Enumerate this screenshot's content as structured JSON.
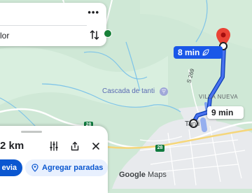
{
  "top_card": {
    "more_label": "•••",
    "destination_partial": "lor"
  },
  "route": {
    "primary_time": "8 min",
    "alt_time": "9 min"
  },
  "map": {
    "poi_name": "Cascada de tanti",
    "town_1": "VILLA NUEVA",
    "town_2": "Tanti",
    "road_s269": "S 269",
    "road_badge_a": "28",
    "road_badge_b": "28",
    "attribution_google": "Google",
    "attribution_maps": " Maps"
  },
  "sheet": {
    "distance": "2 km",
    "start_label": "evia",
    "add_stops_label": "Agregar paradas"
  },
  "colors": {
    "route_primary": "#1a57e8",
    "route_alt": "#7fa0ef",
    "map_green": "#cfe8d6",
    "map_urban": "#e8eaed",
    "water": "#7fc4e8",
    "destination_pin": "#ea4335"
  },
  "icons": {
    "swap": "swap-vertical-icon",
    "leaf": "eco-leaf-icon",
    "tune": "tune-icon",
    "share": "share-icon",
    "close": "close-icon",
    "add_stop": "add-location-icon",
    "pin": "destination-pin-icon",
    "poi": "waterfall-poi-icon"
  }
}
